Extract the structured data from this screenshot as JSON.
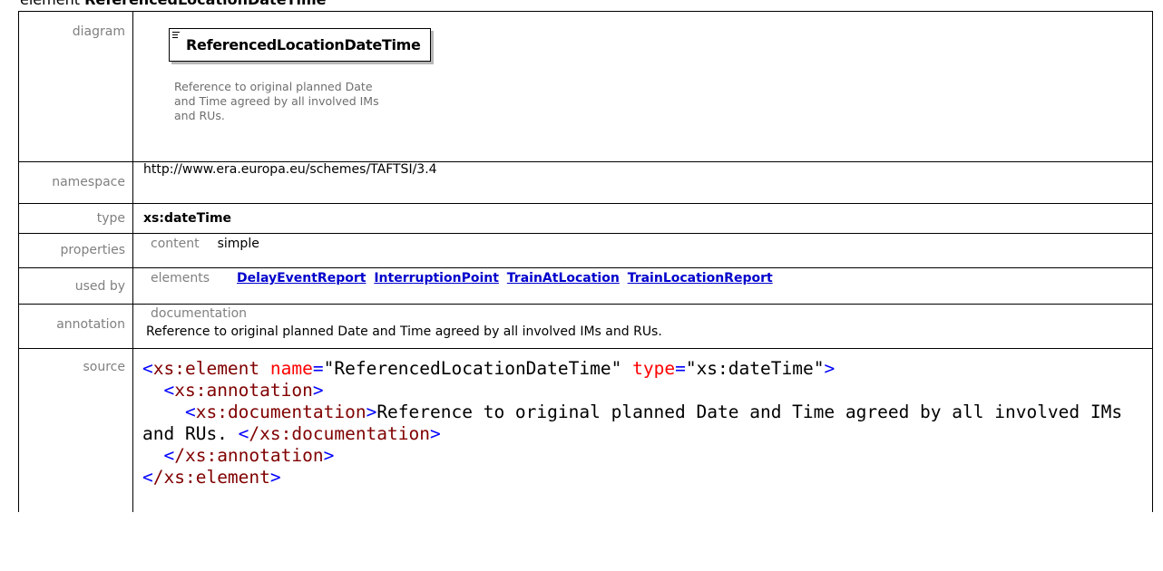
{
  "heading": {
    "prefix": "element",
    "name": "ReferencedLocationDateTime"
  },
  "labels": {
    "diagram": "diagram",
    "namespace": "namespace",
    "type": "type",
    "properties": "properties",
    "used_by": "used by",
    "annotation": "annotation",
    "source": "source"
  },
  "diagram": {
    "element_name": "ReferencedLocationDateTime",
    "description": "Reference to original planned Date and Time agreed by all involved IMs and RUs.",
    "icon": "sequence-lines-icon"
  },
  "namespace": "http://www.era.europa.eu/schemes/TAFTSI/3.4",
  "type": "xs:dateTime",
  "properties": {
    "key": "content",
    "value": "simple"
  },
  "used_by": {
    "key": "elements",
    "links": [
      "DelayEventReport",
      "InterruptionPoint",
      "TrainAtLocation",
      "TrainLocationReport"
    ]
  },
  "annotation": {
    "key": "documentation",
    "text": "Reference to original planned Date and Time agreed by all involved IMs and RUs."
  },
  "source": {
    "open_lt": "<",
    "el_name": "xs:element",
    "attr1": "name",
    "val1": "\"ReferencedLocationDateTime\"",
    "attr2": "type",
    "val2": "\"xs:dateTime\"",
    "gt": ">",
    "ann_open": "xs:annotation",
    "doc_open": "xs:documentation",
    "doc_text": "Reference to original planned Date and Time agreed by all involved IMs and RUs. ",
    "doc_close": "/xs:documentation",
    "ann_close": "/xs:annotation",
    "el_close": "/xs:element"
  },
  "colors": {
    "link": "#0000cc",
    "tag": "#0000ff",
    "element_name": "#800000",
    "attribute": "#ff0000"
  }
}
